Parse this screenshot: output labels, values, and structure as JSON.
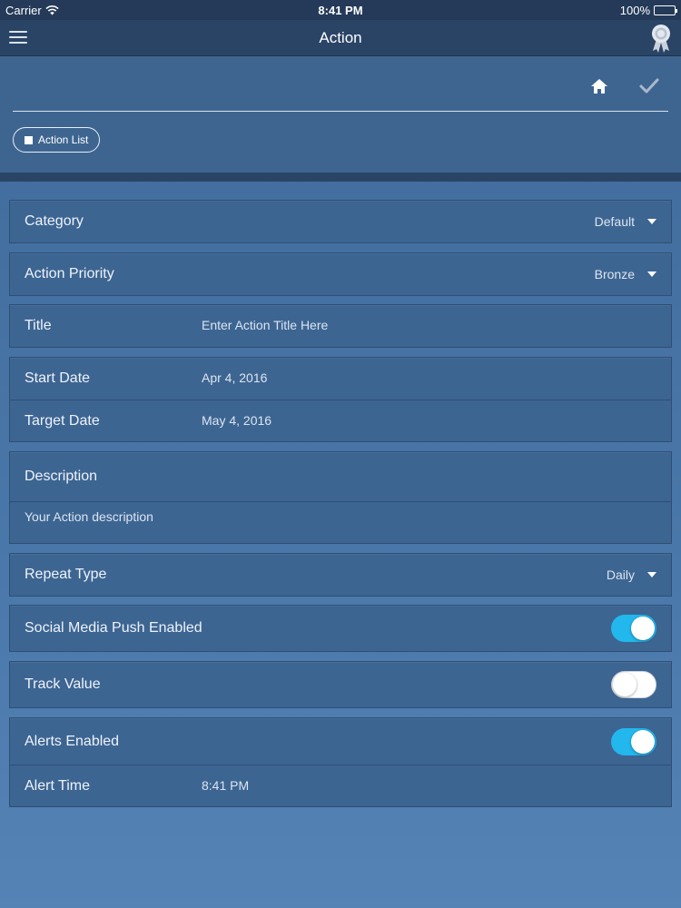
{
  "status_bar": {
    "carrier": "Carrier",
    "time": "8:41 PM",
    "battery": "100%"
  },
  "nav": {
    "title": "Action"
  },
  "header": {
    "action_list_label": "Action List"
  },
  "fields": {
    "category": {
      "label": "Category",
      "value": "Default"
    },
    "priority": {
      "label": "Action Priority",
      "value": "Bronze"
    },
    "title": {
      "label": "Title",
      "placeholder": "Enter Action Title Here"
    },
    "start_date": {
      "label": "Start Date",
      "value": "Apr 4, 2016"
    },
    "target_date": {
      "label": "Target Date",
      "value": "May 4, 2016"
    },
    "description": {
      "label": "Description",
      "placeholder": "Your Action description"
    },
    "repeat_type": {
      "label": "Repeat Type",
      "value": "Daily"
    },
    "social_push": {
      "label": "Social Media Push Enabled",
      "enabled": true
    },
    "track_value": {
      "label": "Track Value",
      "enabled": false
    },
    "alerts": {
      "label": "Alerts Enabled",
      "enabled": true
    },
    "alert_time": {
      "label": "Alert Time",
      "value": "8:41 PM"
    }
  },
  "colors": {
    "toggle_on": "#22b8ee",
    "nav_bar": "#2a4466",
    "background": "#4a77a9"
  },
  "icons": [
    "menu-icon",
    "award-icon",
    "home-icon",
    "checkmark-icon",
    "square-icon",
    "chevron-down-icon",
    "wifi-icon",
    "battery-icon"
  ]
}
